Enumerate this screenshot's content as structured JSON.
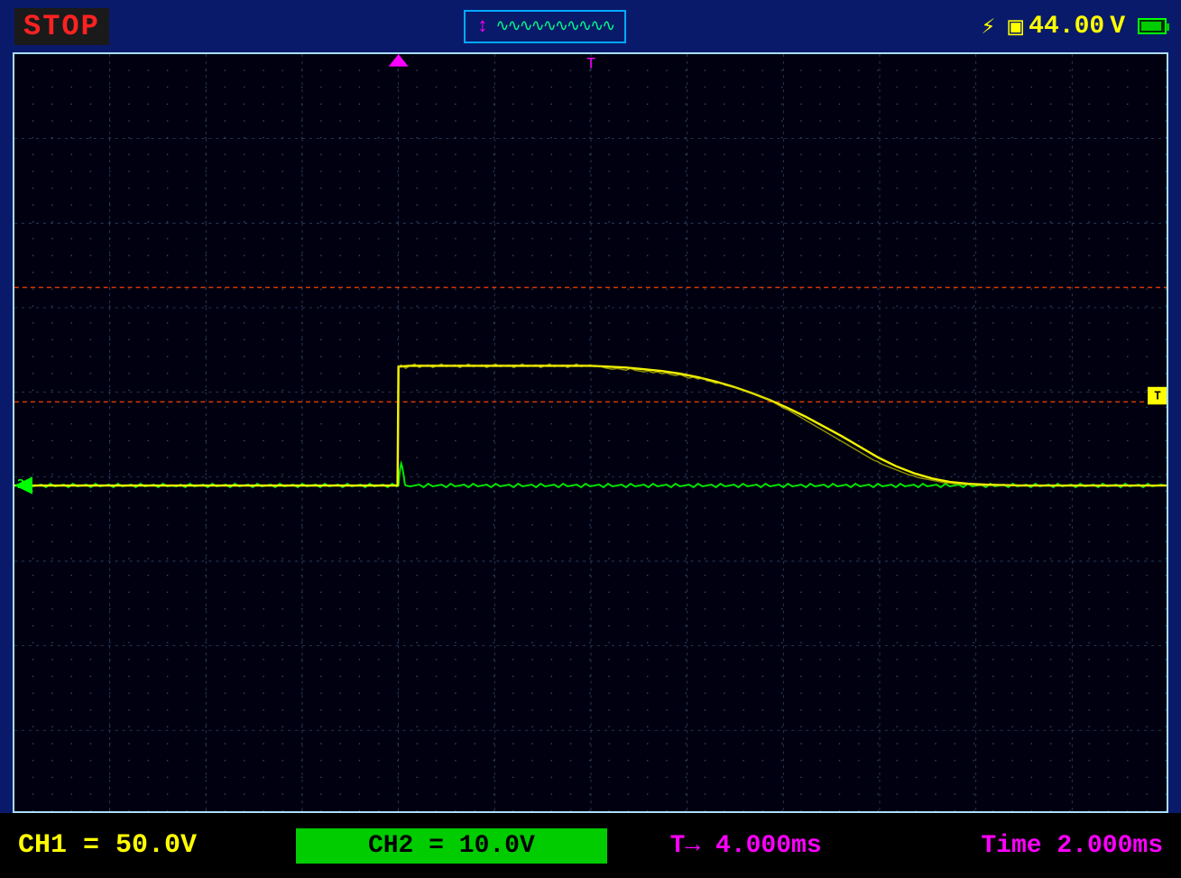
{
  "topBar": {
    "stopLabel": "STOP",
    "voltageDisplay": "44.00",
    "voltageUnit": "V",
    "triggerWave": "∿∿∿∿∿∿∿∿∿∿"
  },
  "screen": {
    "triggerChannel": "T",
    "ch2GroundLabel": "2",
    "chTMarker": "T",
    "gridCols": 12,
    "gridRows": 9
  },
  "bottomBar": {
    "ch1Label": "CH1 = 50.0V",
    "ch2Label": "CH2 = 10.0V",
    "triggerLabel": "T→  4.000ms",
    "timeLabel": "Time 2.000ms"
  }
}
